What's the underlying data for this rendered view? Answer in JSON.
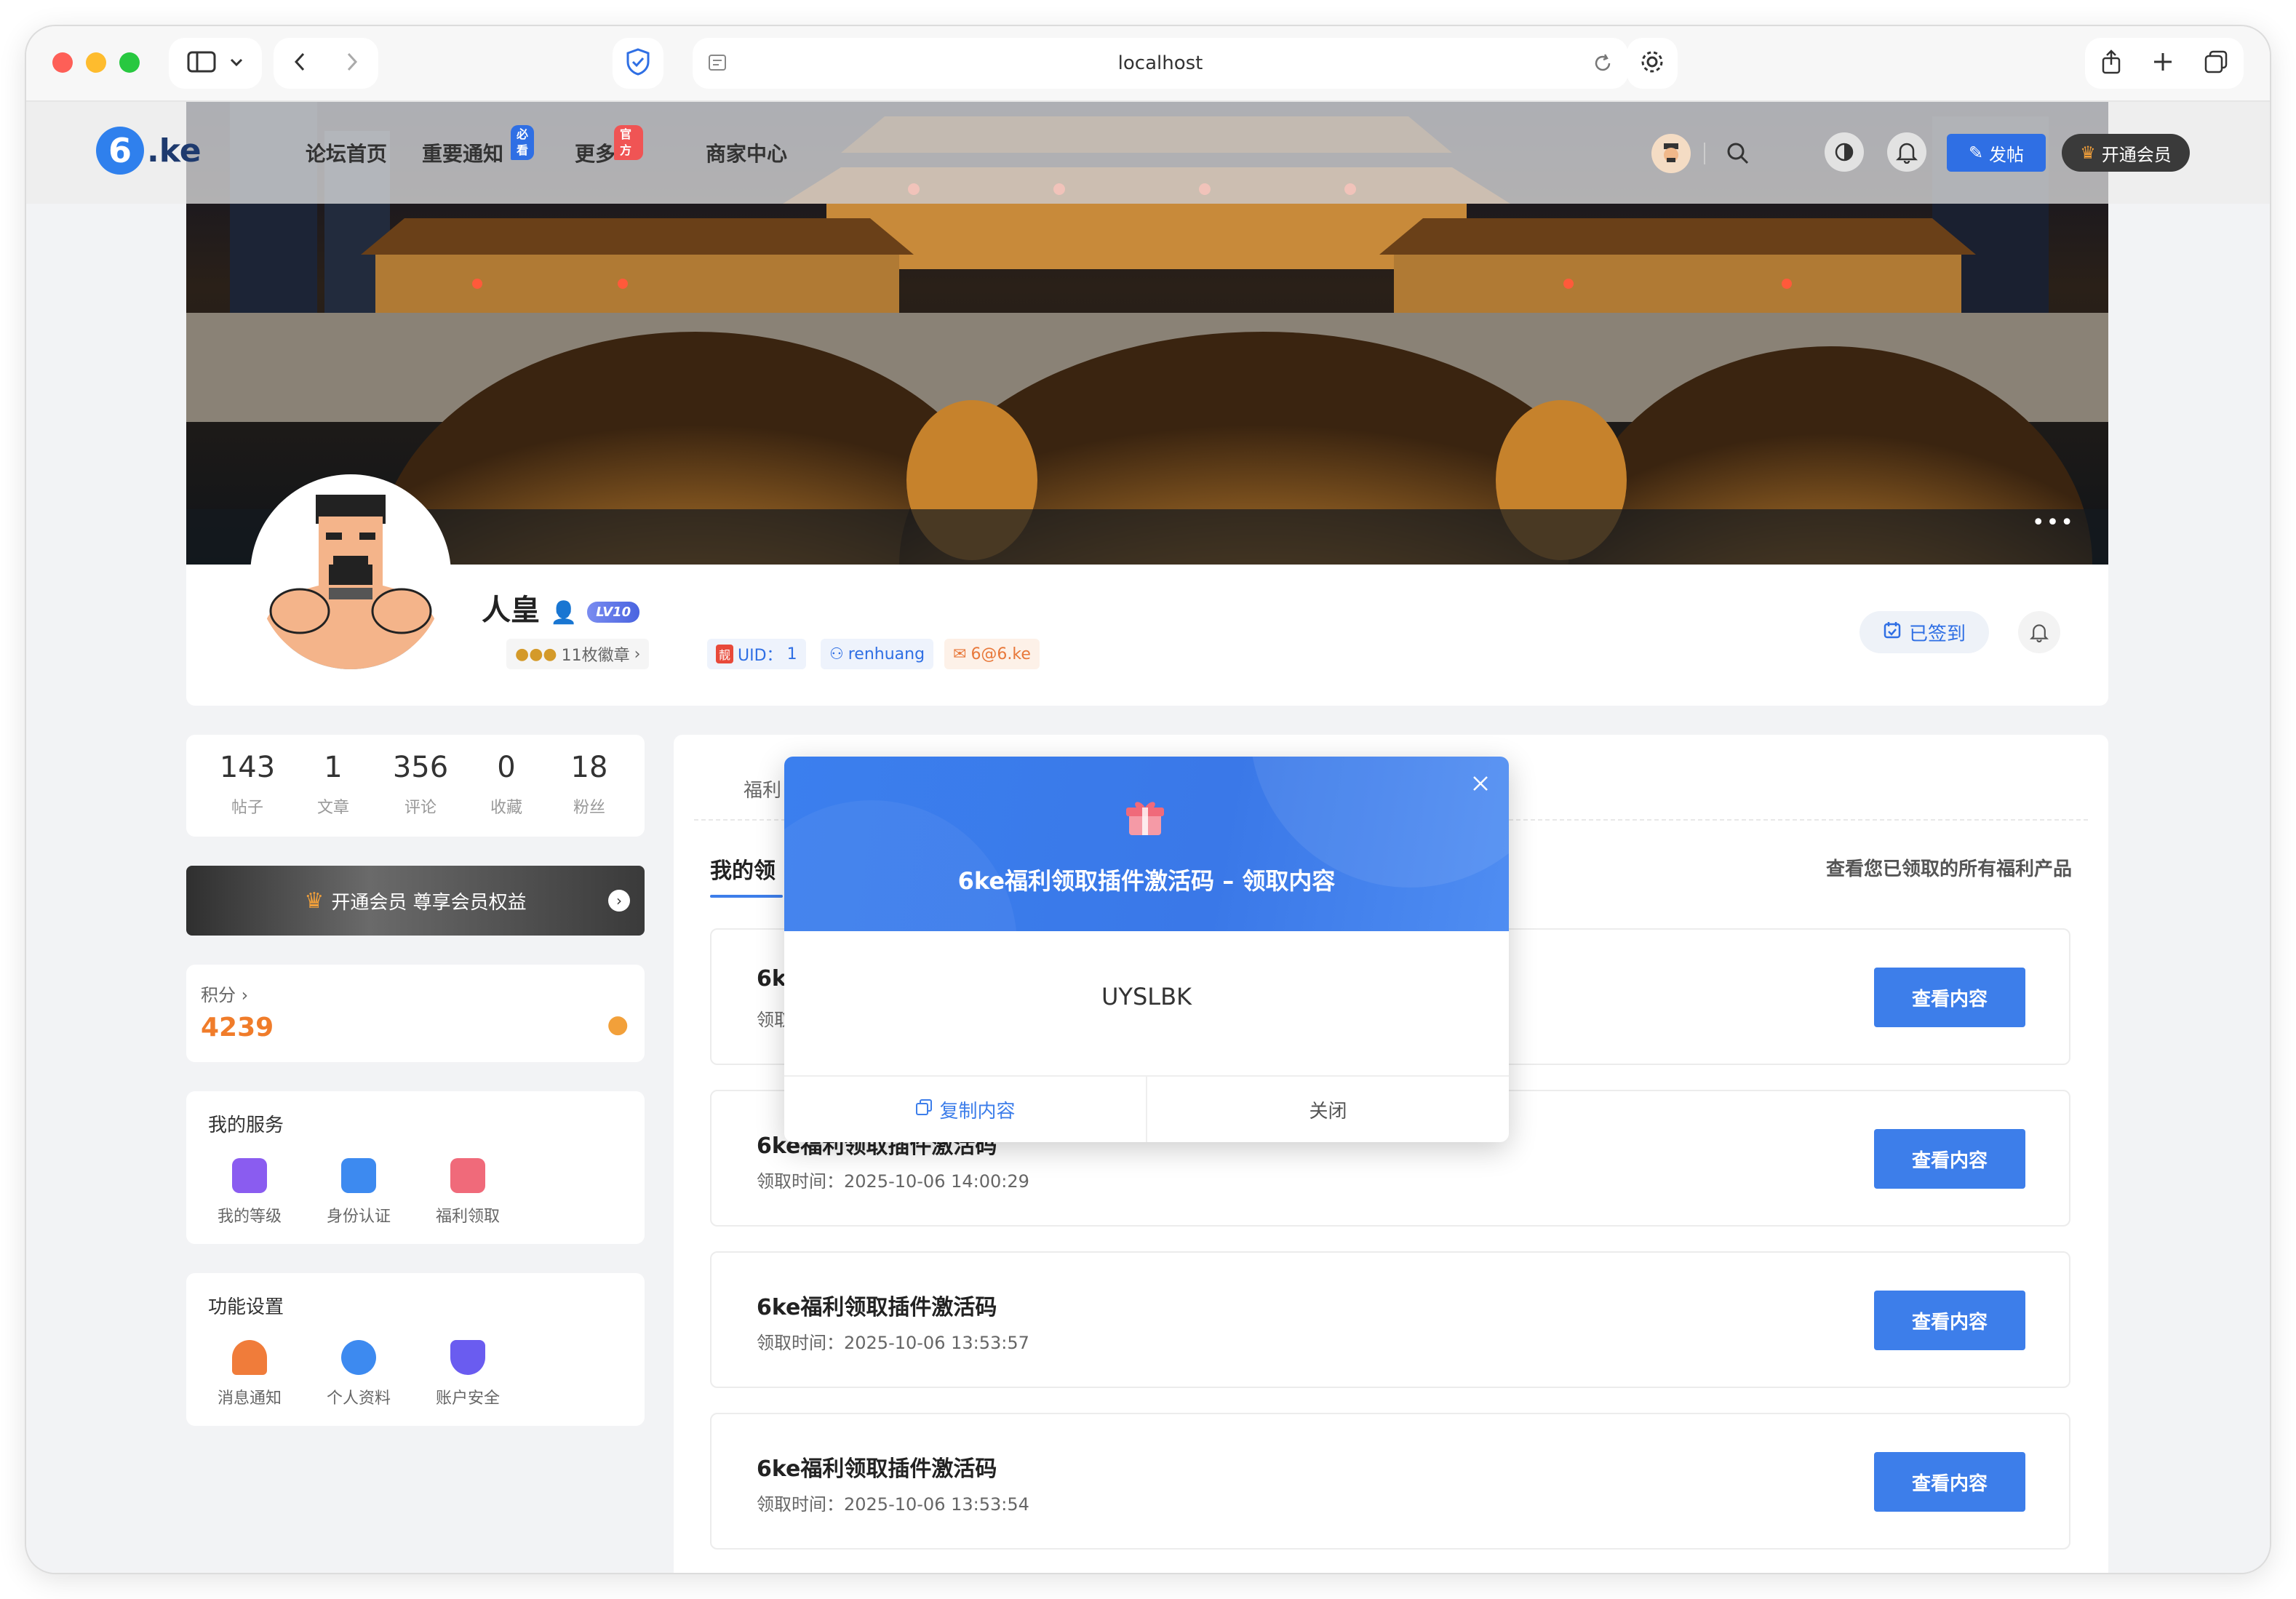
{
  "browser": {
    "url": "localhost"
  },
  "nav": {
    "logo_text": ".ke",
    "logo_mark": "6",
    "menu": [
      {
        "label": "论坛首页"
      },
      {
        "label": "重要通知",
        "badge": "必看"
      },
      {
        "label": "更多",
        "badge": "官方"
      },
      {
        "label": "商家中心"
      }
    ],
    "post_button": "发帖",
    "vip_button": "开通会员"
  },
  "profile": {
    "name": "人皇",
    "level": "LV10",
    "medals": "11枚徽章",
    "uid_label": "UID：",
    "uid": "1",
    "username": "renhuang",
    "email": "6@6.ke",
    "uid_icon": "靓",
    "signed_label": "已签到"
  },
  "stats": [
    {
      "value": "143",
      "label": "帖子"
    },
    {
      "value": "1",
      "label": "文章"
    },
    {
      "value": "356",
      "label": "评论"
    },
    {
      "value": "0",
      "label": "收藏"
    },
    {
      "value": "18",
      "label": "粉丝"
    }
  ],
  "vip_bar": "开通会员 尊享会员权益",
  "points": {
    "label": "积分",
    "value": "4239"
  },
  "services": {
    "title": "我的服务",
    "items": [
      {
        "label": "我的等级",
        "icon": "level-icon"
      },
      {
        "label": "身份认证",
        "icon": "id-card-icon"
      },
      {
        "label": "福利领取",
        "icon": "gift-icon"
      }
    ]
  },
  "settings": {
    "title": "功能设置",
    "items": [
      {
        "label": "消息通知",
        "icon": "bell-icon"
      },
      {
        "label": "个人资料",
        "icon": "user-profile-icon"
      },
      {
        "label": "账户安全",
        "icon": "shield-icon"
      }
    ]
  },
  "main": {
    "tab": "福利",
    "section_title": "我的领",
    "section_desc": "查看您已领取的所有福利产品",
    "items": [
      {
        "title": "6k",
        "time_prefix": "领取"
      },
      {
        "title": "6ke福利领取插件激活码",
        "time": "领取时间：2025-10-06 14:00:29"
      },
      {
        "title": "6ke福利领取插件激活码",
        "time": "领取时间：2025-10-06 13:53:57"
      },
      {
        "title": "6ke福利领取插件激活码",
        "time": "领取时间：2025-10-06 13:53:54"
      }
    ],
    "view_button": "查看内容"
  },
  "modal": {
    "title": "6ke福利领取插件激活码 – 领取内容",
    "content": "UYSLBK",
    "copy_button": "复制内容",
    "close_button": "关闭"
  },
  "colors": {
    "primary": "#3d7eea",
    "points": "#f07c2a",
    "modal_header": "#3b7fee"
  }
}
